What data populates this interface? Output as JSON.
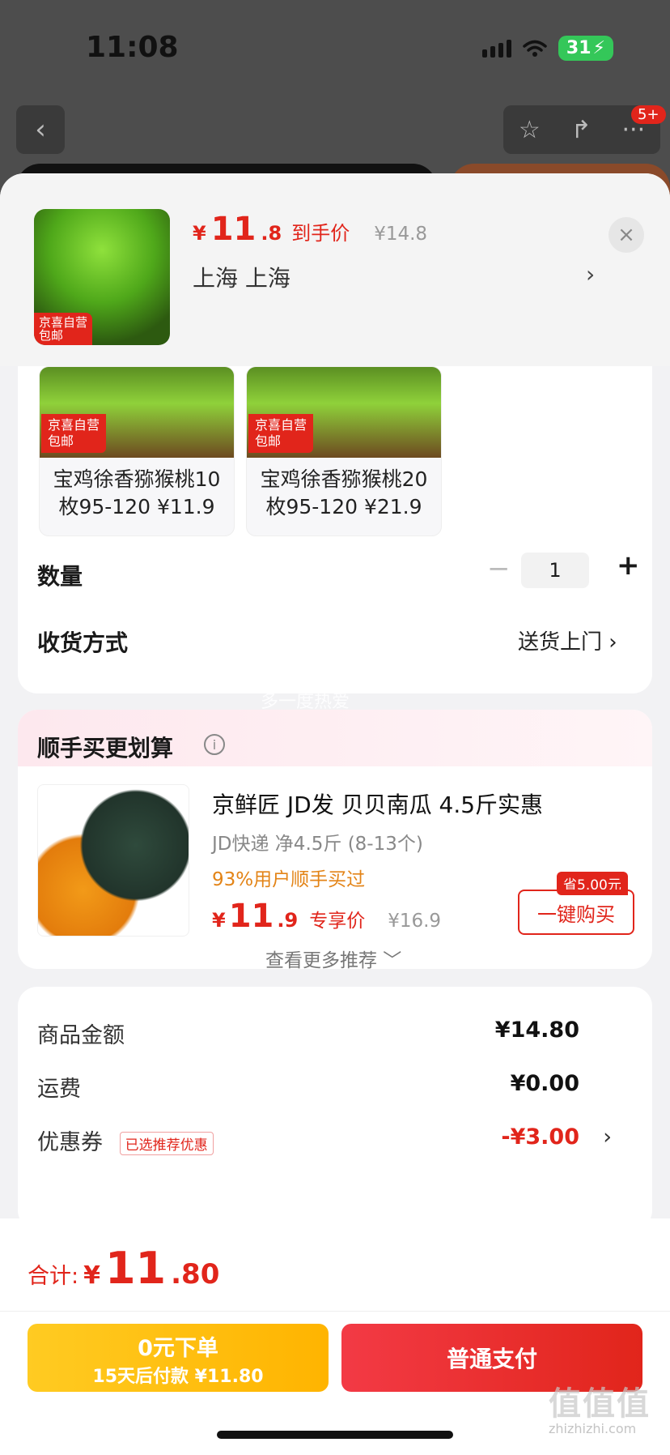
{
  "status_bar": {
    "time": "11:08",
    "battery": "31"
  },
  "nav": {
    "badge": "5+"
  },
  "header": {
    "thumb_badge_line1": "京喜自营",
    "thumb_badge_line2": "包邮",
    "currency": "¥",
    "price_int": "11",
    "price_dec": ".8",
    "price_tag": "到手价",
    "original_price": "¥14.8",
    "address": "上海  上海",
    "address_arrow": "›",
    "close": "×"
  },
  "variants": [
    {
      "badge_line1": "京喜自营",
      "badge_line2": "包邮",
      "text": "宝鸡徐香猕猴桃10枚95-120 ¥11.9"
    },
    {
      "badge_line1": "京喜自营",
      "badge_line2": "包邮",
      "text": "宝鸡徐香猕猴桃20枚95-120 ¥21.9"
    }
  ],
  "quantity": {
    "label": "数量",
    "minus": "−",
    "value": "1",
    "plus": "+"
  },
  "shipping": {
    "label": "收货方式",
    "value": "送货上门 ›"
  },
  "watermark": "多一度热爱",
  "upsell": {
    "title": "顺手买更划算",
    "info_icon": "i",
    "product_name": "京鲜匠 JD发 贝贝南瓜 4.5斤实惠",
    "spec": "JD快递 净4.5斤 (8-13个)",
    "buyers": "93%用户顺手买过",
    "currency": "¥",
    "price_int": "11",
    "price_dec": ".9",
    "price_tag": "专享价",
    "original_price": "¥16.9",
    "save_badge": "省5.00元",
    "buy_button": "一键购买",
    "more_link": "查看更多推荐 ﹀"
  },
  "summary": {
    "items_label": "商品金额",
    "items_value": "¥14.80",
    "freight_label": "运费",
    "freight_value": "¥0.00",
    "coupon_label": "优惠券",
    "coupon_tag": "已选推荐优惠",
    "coupon_value": "-¥3.00",
    "coupon_arrow": "›"
  },
  "bottom": {
    "total_label": "合计:",
    "currency": "¥",
    "total_int": "11",
    "total_dec": ".80",
    "zero_line1": "0元下单",
    "zero_line2": "15天后付款 ¥11.80",
    "pay_button": "普通支付"
  },
  "corner_watermark": {
    "mark": "值值值",
    "url": "zhizhizhi.com"
  },
  "colors": {
    "accent_red": "#e1251b",
    "accent_yellow": "#ffc21a",
    "buyer_orange": "#e38417"
  },
  "icons": [
    "back-icon",
    "star-icon",
    "share-icon",
    "more-icon",
    "close-icon",
    "info-icon",
    "chevron-right-icon"
  ]
}
